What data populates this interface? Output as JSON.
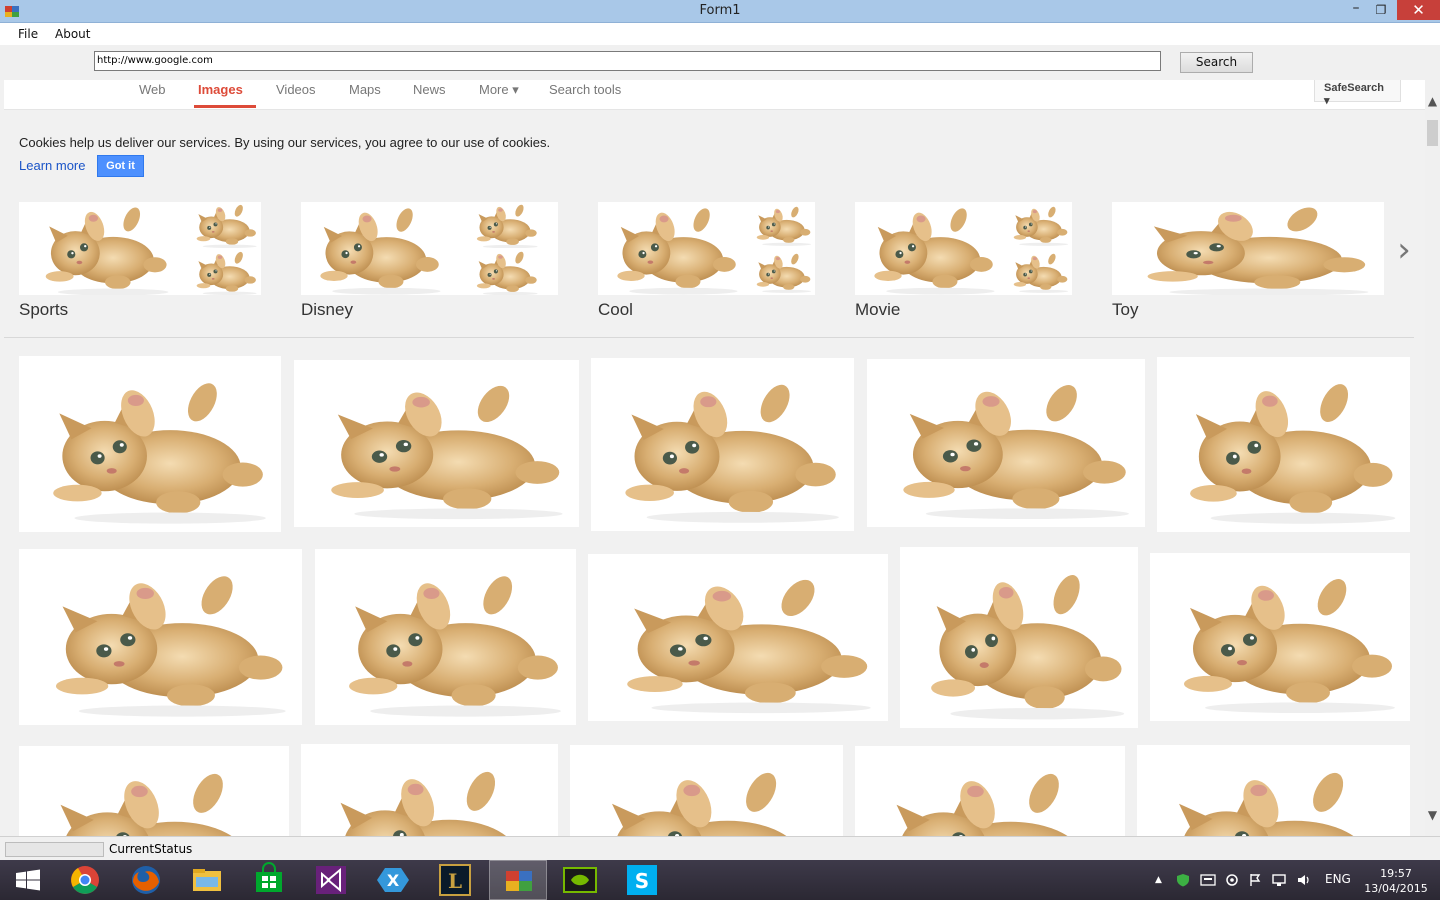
{
  "window": {
    "title": "Form1",
    "min": "–",
    "max": "❐",
    "close": "✕"
  },
  "menu": {
    "file": "File",
    "about": "About"
  },
  "address": {
    "url": "http://www.google.com",
    "search_label": "Search"
  },
  "google_nav": {
    "tabs": [
      "Web",
      "Images",
      "Videos",
      "Maps",
      "News",
      "More ▾",
      "Search tools"
    ],
    "active_tab": "Images",
    "safesearch": "SafeSearch ▾"
  },
  "cookie_notice": {
    "text": "Cookies help us deliver our services. By using our services, you agree to our use of cookies.",
    "learn_more": "Learn more",
    "got_it": "Got it"
  },
  "categories": [
    "Sports",
    "Disney",
    "Cool",
    "Movie",
    "Toy"
  ],
  "next_arrow": "›",
  "status": {
    "text": "CurrentStatus"
  },
  "scroll": {
    "up": "▲",
    "down": "▼"
  },
  "taskbar": {
    "apps": [
      "start-icon",
      "chrome-icon",
      "firefox-icon",
      "file-explorer-icon",
      "store-icon",
      "visual-studio-icon",
      "xamarin-icon",
      "league-icon",
      "winforms-app-icon",
      "nvidia-icon",
      "skype-icon"
    ],
    "language": "ENG",
    "time": "19:57",
    "date": "13/04/2015"
  },
  "colors": {
    "google_red": "#dd4b39",
    "google_blue": "#4d90fe",
    "link_blue": "#1a54c8"
  }
}
